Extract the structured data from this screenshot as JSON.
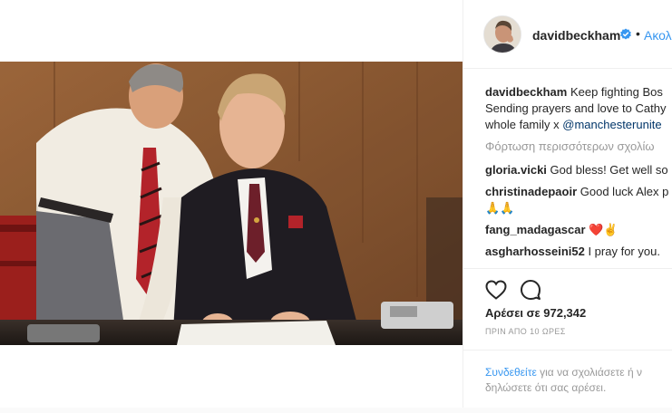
{
  "post": {
    "username": "davidbeckham",
    "follow_label": "Ακολ",
    "separator": "•",
    "caption": {
      "username": "davidbeckham",
      "line1": "Keep fighting Bos",
      "line2": "Sending prayers and love to Cathy",
      "line3_prefix": "whole family x ",
      "mention": "@manchesterunite"
    },
    "load_more": "Φόρτωση περισσότερων σχολίω",
    "comments": [
      {
        "username": "gloria.vicki",
        "text": "God bless! Get well so"
      },
      {
        "username": "christinadepaoir",
        "text": "Good luck Alex p"
      },
      {
        "username": "",
        "text": "🙏🙏"
      },
      {
        "username": "fang_madagascar",
        "text": "❤️✌️"
      },
      {
        "username": "asgharhosseini52",
        "text": "I pray for you."
      }
    ],
    "likes": "Αρέσει σε 972,342",
    "time_ago": "ΠΡΙΝ ΑΠΟ 10 ΩΡΕΣ",
    "login_prompt": {
      "link": "Συνδεθείτε",
      "rest_line1": " για να σχολιάσετε ή ν",
      "line2": "δηλώσετε ότι σας αρέσει."
    }
  },
  "icons": {
    "verified": "verified-badge-icon",
    "like": "heart-icon",
    "comment": "comment-icon"
  },
  "colors": {
    "link": "#3897f0",
    "mention": "#003569",
    "muted": "#999999",
    "text": "#262626",
    "heart_emoji": "#e0245e"
  }
}
